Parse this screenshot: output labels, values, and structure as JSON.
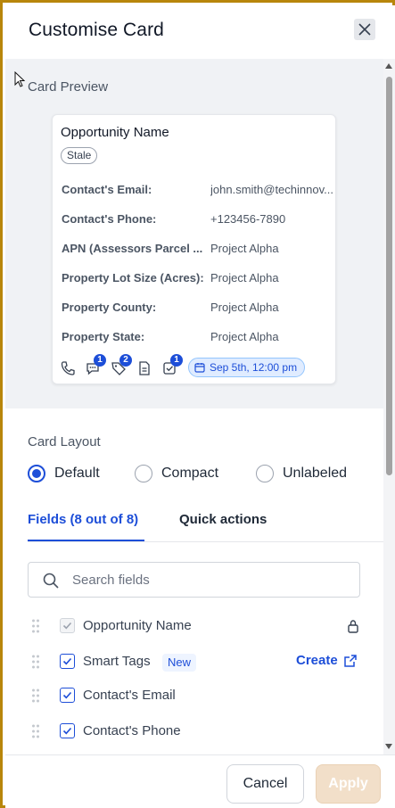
{
  "header": {
    "title": "Customise Card"
  },
  "preview": {
    "label": "Card Preview",
    "card": {
      "title": "Opportunity Name",
      "tag": "Stale",
      "fields": [
        {
          "label": "Contact's Email:",
          "value": "john.smith@techinnov..."
        },
        {
          "label": "Contact's Phone:",
          "value": "+123456-7890"
        },
        {
          "label": "APN (Assessors Parcel ...",
          "value": "Project Alpha"
        },
        {
          "label": "Property Lot Size (Acres):",
          "value": "Project Alpha"
        },
        {
          "label": "Property County:",
          "value": "Project Alpha"
        },
        {
          "label": "Property State:",
          "value": "Project Alpha"
        }
      ],
      "icons": {
        "phone": "phone-icon",
        "chat": {
          "icon": "chat-icon",
          "badge": "1"
        },
        "tag": {
          "icon": "tag-icon",
          "badge": "2"
        },
        "document": "document-icon",
        "task": {
          "icon": "task-icon",
          "badge": "1"
        }
      },
      "date": "Sep 5th, 12:00 pm"
    }
  },
  "layout": {
    "label": "Card Layout",
    "options": [
      "Default",
      "Compact",
      "Unlabeled"
    ],
    "selected": "Default"
  },
  "tabs": {
    "fields": "Fields (8 out of 8)",
    "quick_actions": "Quick actions",
    "active": "fields"
  },
  "search": {
    "placeholder": "Search fields"
  },
  "field_list": [
    {
      "label": "Opportunity Name",
      "checked": true,
      "locked": true
    },
    {
      "label": "Smart Tags",
      "checked": true,
      "badge": "New",
      "action": "Create"
    },
    {
      "label": "Contact's Email",
      "checked": true
    },
    {
      "label": "Contact's Phone",
      "checked": true
    }
  ],
  "footer": {
    "cancel": "Cancel",
    "apply": "Apply"
  },
  "colors": {
    "accent": "#1d4ed8",
    "frame": "#b8860b",
    "apply_disabled": "#f2dfc9"
  }
}
